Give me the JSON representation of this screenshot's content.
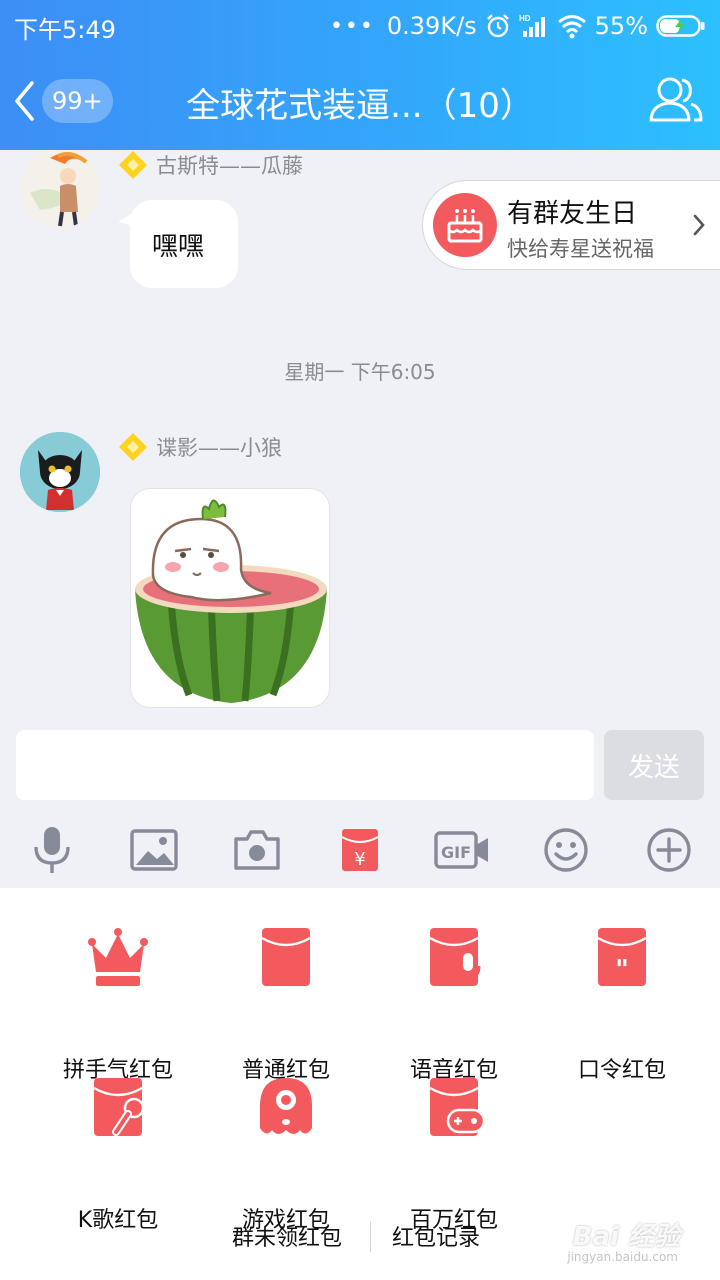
{
  "status_bar": {
    "time": "下午5:49",
    "dots": "•••",
    "net_speed": "0.39K/s",
    "battery_percent": "55%",
    "battery_level": 0.55
  },
  "nav": {
    "back_badge": "99+",
    "title": "全球花式装逼...（10）"
  },
  "messages": [
    {
      "sender": "古斯特——瓜藤",
      "text": "嘿嘿"
    },
    {
      "sender": "谍影——小狼",
      "sticker": "watermelon-radish-sticker"
    }
  ],
  "timestamp": "星期一 下午6:05",
  "birthday_banner": {
    "title": "有群友生日",
    "subtitle": "快给寿星送祝福"
  },
  "input": {
    "placeholder": "",
    "send_label": "发送"
  },
  "toolbar": {
    "icons": [
      "microphone-icon",
      "image-icon",
      "camera-icon",
      "red-packet-icon",
      "gif-icon",
      "emoji-icon",
      "plus-icon"
    ],
    "active": "red-packet-icon",
    "active_color": "#f25a5d",
    "icon_color": "#878a99"
  },
  "red_packets": [
    {
      "label": "拼手气红包",
      "icon": "crown-icon"
    },
    {
      "label": "普通红包",
      "icon": "envelope-icon"
    },
    {
      "label": "语音红包",
      "icon": "voice-envelope-icon"
    },
    {
      "label": "口令红包",
      "icon": "quote-envelope-icon"
    },
    {
      "label": "K歌红包",
      "icon": "karaoke-envelope-icon"
    },
    {
      "label": "游戏红包",
      "icon": "game-character-icon"
    },
    {
      "label": "百万红包",
      "icon": "gamepad-envelope-icon"
    }
  ],
  "footer": {
    "unclaimed": "群未领红包",
    "records": "红包记录"
  },
  "watermark": {
    "brand": "Bai 经验",
    "url": "jingyan.baidu.com"
  },
  "colors": {
    "header_start": "#3d8ef6",
    "header_end": "#2cc0fe",
    "red": "#f25a5d"
  }
}
